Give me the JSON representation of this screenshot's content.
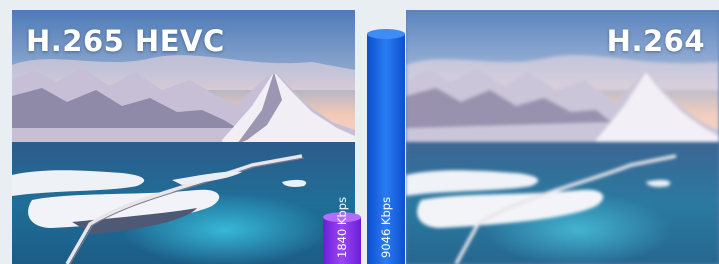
{
  "labels": {
    "left_codec": "H.265 HEVC",
    "right_codec": "H.264"
  },
  "colors": {
    "hevc_bar": "#8b2ff0",
    "h264_bar": "#1a63e6",
    "background": "#e9eef2"
  },
  "chart_data": {
    "type": "bar",
    "categories": [
      "H.265 HEVC",
      "H.264"
    ],
    "values": [
      1840,
      9046
    ],
    "value_labels": [
      "1840 Kbps",
      "9046 Kbps"
    ],
    "unit": "Kbps",
    "ylim": [
      0,
      9046
    ],
    "grid": false
  }
}
